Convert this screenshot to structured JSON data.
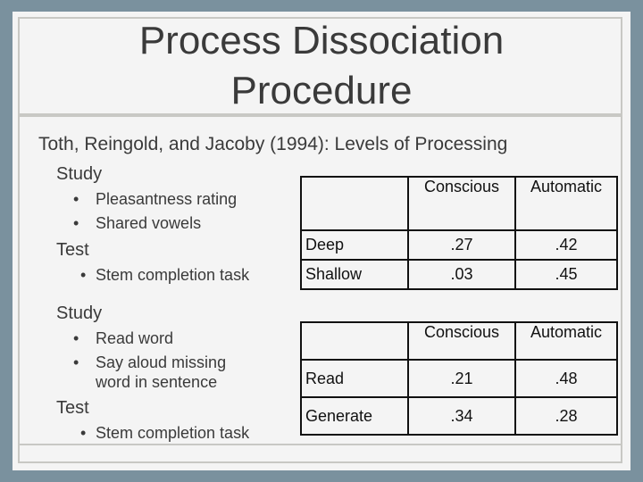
{
  "slide": {
    "title_line1": "Process Dissociation",
    "title_line2": "Procedure",
    "subtitle": "Toth, Reingold, and Jacoby (1994): Levels of Processing",
    "experiment1": {
      "study_label": "Study",
      "study_items": [
        "Pleasantness rating",
        "Shared vowels"
      ],
      "test_label": "Test",
      "test_items": [
        "Stem completion task"
      ]
    },
    "experiment2": {
      "study_label": "Study",
      "study_items": [
        "Read word",
        "Say aloud missing",
        "word in sentence"
      ],
      "test_label": "Test",
      "test_items": [
        "Stem completion task"
      ]
    },
    "table1": {
      "headers": [
        "",
        "Conscious",
        "Automatic"
      ],
      "rows": [
        {
          "label": "Deep",
          "conscious": ".27",
          "automatic": ".42"
        },
        {
          "label": "Shallow",
          "conscious": ".03",
          "automatic": ".45"
        }
      ]
    },
    "table2": {
      "headers": [
        "",
        "Conscious",
        "Automatic"
      ],
      "rows": [
        {
          "label": "Read",
          "conscious": ".21",
          "automatic": ".48"
        },
        {
          "label": "Generate",
          "conscious": ".34",
          "automatic": ".28"
        }
      ]
    },
    "bullet": "•"
  }
}
